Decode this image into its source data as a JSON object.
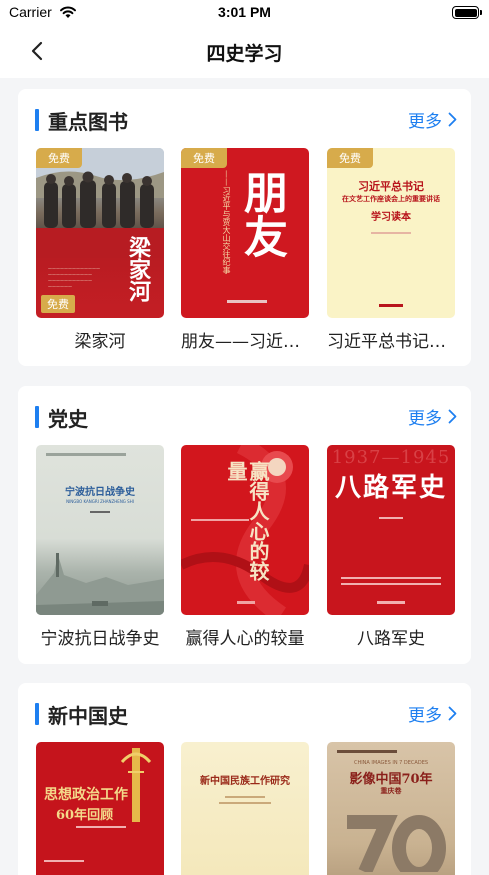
{
  "status_bar": {
    "carrier": "Carrier",
    "time": "3:01 PM"
  },
  "nav": {
    "title": "四史学习",
    "back_icon": "chevron-left-icon"
  },
  "sections": [
    {
      "title": "重点图书",
      "more_label": "更多",
      "books": [
        {
          "title": "梁家河",
          "badge": "免费",
          "cover_title": "梁家河"
        },
        {
          "title": "朋友——习近平与贾大山交往纪事",
          "badge": "免费",
          "cover_title": "朋友",
          "cover_subtitle": "——习近平与贾大山交往纪事"
        },
        {
          "title": "习近平总书记在文艺工作座谈会上的重要讲话学习读本",
          "badge": "免费",
          "cover_title_lines": [
            "习近平总书记",
            "在文艺工作座谈会上的重要讲话",
            "学习读本"
          ]
        }
      ]
    },
    {
      "title": "党史",
      "more_label": "更多",
      "books": [
        {
          "title": "宁波抗日战争史",
          "cover_title": "宁波抗日战争史",
          "cover_pinyin": "NINGBO KANGRI ZHANZHENG SHI"
        },
        {
          "title": "赢得人心的较量",
          "cover_title": "赢得人心的较量"
        },
        {
          "title": "八路军史",
          "cover_title": "八路军史",
          "cover_year": "1937—1945"
        }
      ]
    },
    {
      "title": "新中国史",
      "more_label": "更多",
      "books": [
        {
          "title": "思想政治工作60年回顾",
          "cover_title_lines": [
            "思想政治工作",
            "60年回顾"
          ]
        },
        {
          "title": "新中国民族工作研究",
          "cover_title": "新中国民族工作研究"
        },
        {
          "title": "影像中国70年",
          "cover_title": "影像中国70年",
          "cover_en": "CHINA IMAGES IN 7 DECADES",
          "cover_sub": "重庆卷"
        }
      ]
    }
  ],
  "colors": {
    "accent": "#1e7ff0",
    "badge": "#d7ab4b",
    "cover_red": "#c8151d"
  }
}
